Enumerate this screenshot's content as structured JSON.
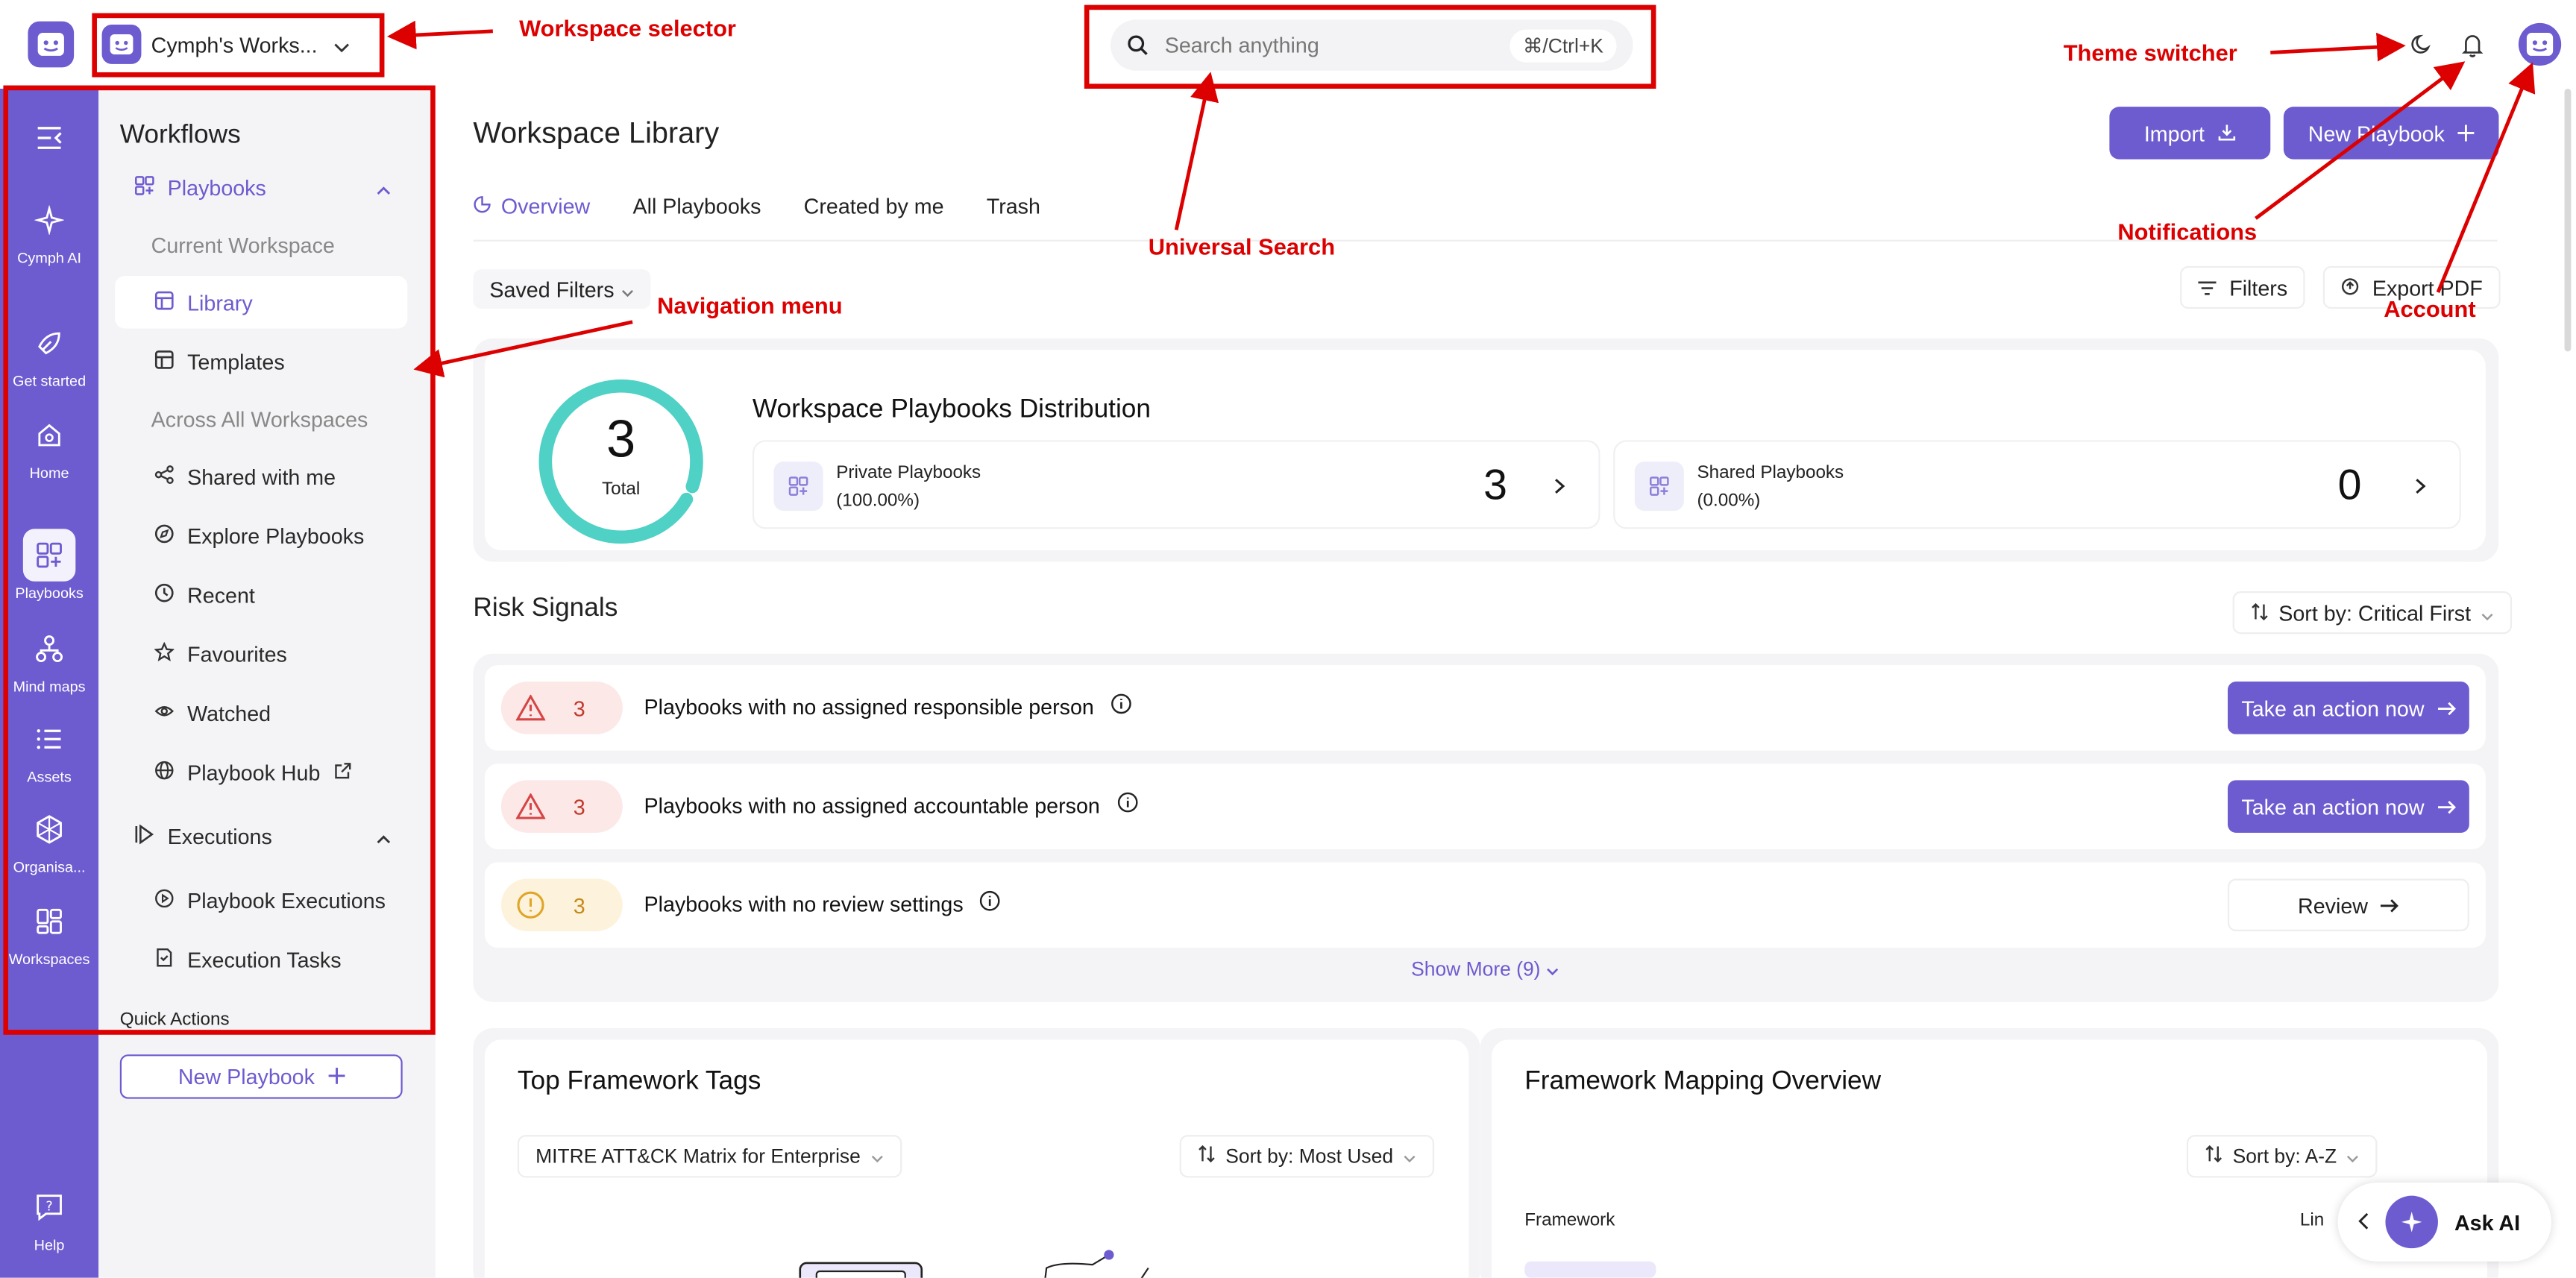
{
  "topbar": {
    "workspace_name": "Cymph's Works...",
    "search_placeholder": "Search anything",
    "search_shortcut": "⌘/Ctrl+K"
  },
  "rail": {
    "items": [
      {
        "label": "Cymph AI",
        "icon": "sparkle-icon"
      },
      {
        "label": "Get started",
        "icon": "rocket-icon"
      },
      {
        "label": "Home",
        "icon": "home-icon"
      },
      {
        "label": "Playbooks",
        "icon": "playbooks-icon",
        "active": true
      },
      {
        "label": "Mind maps",
        "icon": "mindmap-icon"
      },
      {
        "label": "Assets",
        "icon": "list-icon"
      },
      {
        "label": "Organisa...",
        "icon": "org-icon"
      },
      {
        "label": "Workspaces",
        "icon": "workspaces-icon"
      },
      {
        "label": "Help",
        "icon": "help-icon"
      }
    ]
  },
  "subnav": {
    "title": "Workflows",
    "playbooks_label": "Playbooks",
    "group_current": "Current Workspace",
    "library": "Library",
    "templates": "Templates",
    "group_across": "Across All Workspaces",
    "shared": "Shared with me",
    "explore": "Explore Playbooks",
    "recent": "Recent",
    "favourites": "Favourites",
    "watched": "Watched",
    "hub": "Playbook Hub",
    "executions_label": "Executions",
    "pb_executions": "Playbook Executions",
    "exec_tasks": "Execution Tasks",
    "quick_actions": "Quick Actions",
    "new_playbook": "New Playbook"
  },
  "main": {
    "title": "Workspace Library",
    "import_label": "Import",
    "new_playbook_label": "New Playbook",
    "tabs": [
      "Overview",
      "All Playbooks",
      "Created by me",
      "Trash"
    ],
    "saved_filters": "Saved Filters",
    "filters": "Filters",
    "export_pdf": "Export PDF"
  },
  "distribution": {
    "total": "3",
    "total_label": "Total",
    "title": "Workspace Playbooks Distribution",
    "private_label": "Private Playbooks",
    "private_pct": "(100.00%)",
    "private_count": "3",
    "shared_label": "Shared Playbooks",
    "shared_pct": "(0.00%)",
    "shared_count": "0",
    "donut_fraction": 1.0
  },
  "risk": {
    "title": "Risk Signals",
    "sort": "Sort by: Critical First",
    "rows": [
      {
        "count": "3",
        "text": "Playbooks with no assigned responsible person",
        "action": "Take an action now",
        "level": "critical"
      },
      {
        "count": "3",
        "text": "Playbooks with no assigned accountable person",
        "action": "Take an action now",
        "level": "critical"
      },
      {
        "count": "3",
        "text": "Playbooks with no review settings",
        "action": "Review",
        "level": "warning"
      }
    ],
    "show_more": "Show More (9)"
  },
  "framework_tags": {
    "title": "Top Framework Tags",
    "matrix": "MITRE ATT&CK Matrix for Enterprise",
    "sort": "Sort by: Most Used"
  },
  "framework_mapping": {
    "title": "Framework Mapping Overview",
    "sort": "Sort by: A-Z",
    "col_framework": "Framework",
    "col_link": "Lin"
  },
  "ask_ai": "Ask AI",
  "annotations": {
    "workspace_selector": "Workspace selector",
    "universal_search": "Universal Search",
    "navigation_menu": "Navigation menu",
    "theme_switcher": "Theme switcher",
    "notifications": "Notifications",
    "account": "Account"
  },
  "colors": {
    "accent": "#6d5bd0",
    "annotation": "#dd0000",
    "donut": "#4fd1c5",
    "critical_bg": "#fde8e8",
    "warning_bg": "#fdf3dc"
  }
}
